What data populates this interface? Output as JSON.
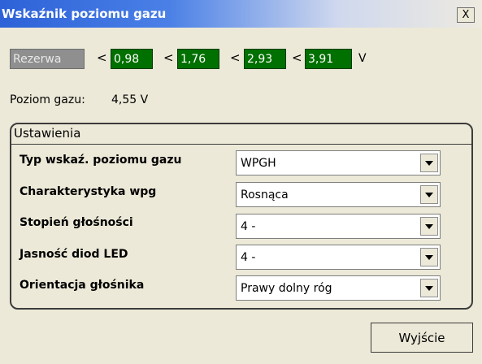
{
  "window": {
    "title": "Wskaźnik poziomu gazu",
    "close_label": "X"
  },
  "thresholds": {
    "reserve_label": "Rezerwa",
    "less_than": "<",
    "values": [
      "0,98",
      "1,76",
      "2,93",
      "3,91"
    ],
    "unit": "V"
  },
  "level": {
    "label": "Poziom gazu:",
    "value": "4,55 V"
  },
  "settings": {
    "title": "Ustawienia",
    "rows": [
      {
        "label": "Typ wskaź. poziomu gazu",
        "value": "WPGH"
      },
      {
        "label": "Charakterystyka wpg",
        "value": "Rosnąca"
      },
      {
        "label": "Stopień głośności",
        "value": "4 -"
      },
      {
        "label": "Jasność diod LED",
        "value": "4 -"
      },
      {
        "label": "Orientacja głośnika",
        "value": "Prawy dolny róg"
      }
    ]
  },
  "footer": {
    "exit_label": "Wyjście"
  },
  "colors": {
    "threshold_green": "#007000",
    "reserve_grey": "#8f8f8f",
    "title_blue": "#2d62d8"
  },
  "icons": {
    "close": "close-icon",
    "dropdown": "chevron-down-icon"
  }
}
